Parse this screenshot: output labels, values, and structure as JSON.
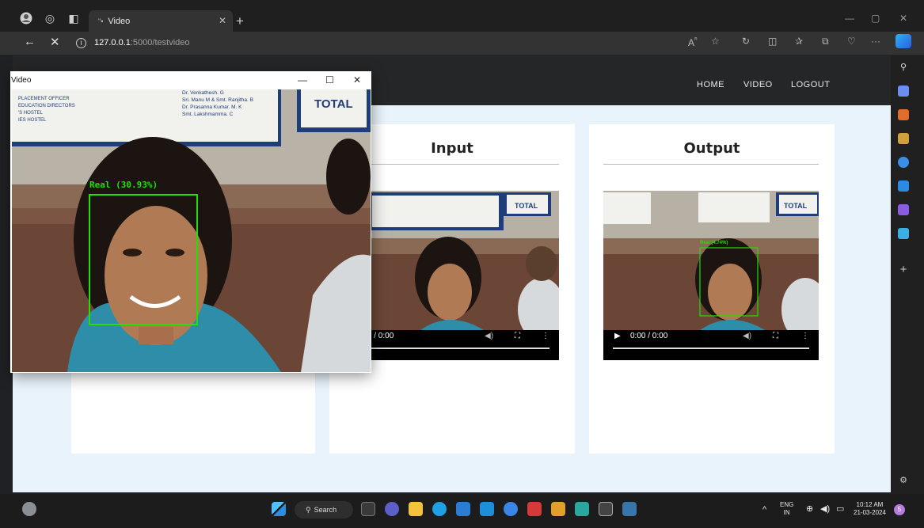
{
  "browser": {
    "tab_title": "Video",
    "tab_icon": "video-tab-icon",
    "url_host": "127.0.0.1",
    "url_path": ":5000/testvideo"
  },
  "navbar": {
    "links": [
      "HOME",
      "VIDEO",
      "LOGOUT"
    ]
  },
  "cards": {
    "input_title": "Input",
    "output_title": "Output"
  },
  "video_input": {
    "time": "0:00 / 0:00"
  },
  "video_output": {
    "time": "0:00 / 0:00",
    "detection_label": "Real (4.74%)"
  },
  "cv_window": {
    "title": "Video",
    "detection_label": "Real (30.93%)",
    "board_text_1": "Dr. Venkathesh. G",
    "board_text_2": "Sri. Manu M & Smt. Ranjitha. B",
    "board_text_3": "Dr. Prasanna Kumar. M. K",
    "board_text_4": "Smt. Lakshmamma. C",
    "board_left_1": "PLACEMENT OFFICER",
    "board_left_2": "EDUCATION DIRECTORS",
    "board_left_3": "'S HOSTEL",
    "board_left_4": "IES HOSTEL",
    "board_total": "TOTAL"
  },
  "taskbar": {
    "search_label": "Search",
    "lang": "ENG",
    "region": "IN",
    "time": "10:12 AM",
    "date": "21-03-2024",
    "notification_count": "5"
  },
  "colors": {
    "navbar": "#252627",
    "page_bg": "#e9f3fb",
    "detection_green": "#22e000"
  }
}
